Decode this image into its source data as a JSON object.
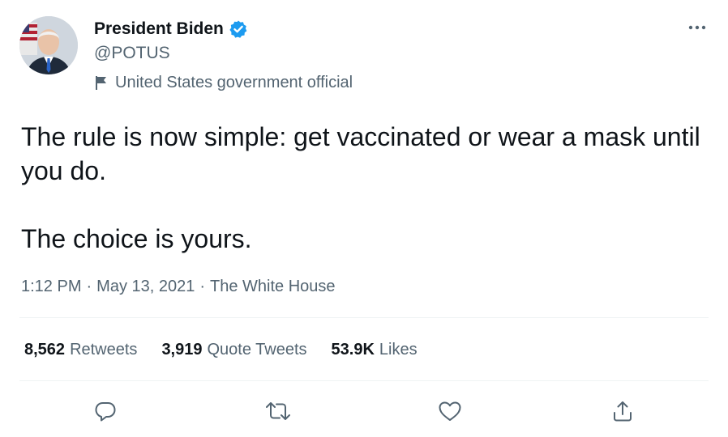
{
  "author": {
    "name": "President Biden",
    "handle": "@POTUS",
    "label": "United States government official",
    "verified": true
  },
  "tweet": {
    "text": "The rule is now simple: get vaccinated or wear a mask until you do.\n\nThe choice is yours.",
    "time": "1:12 PM",
    "date": "May 13, 2021",
    "source": "The White House",
    "separator": "·"
  },
  "stats": {
    "retweets_count": "8,562",
    "retweets_label": "Retweets",
    "quotes_count": "3,919",
    "quotes_label": "Quote Tweets",
    "likes_count": "53.9K",
    "likes_label": "Likes"
  },
  "icons": {
    "more": "more-icon",
    "reply": "reply-icon",
    "retweet": "retweet-icon",
    "like": "heart-icon",
    "share": "share-icon",
    "verified": "verified-badge-icon",
    "label": "flag-icon"
  },
  "colors": {
    "verified_blue": "#1d9bf0",
    "secondary_text": "#536471",
    "primary_text": "#0f1419"
  }
}
